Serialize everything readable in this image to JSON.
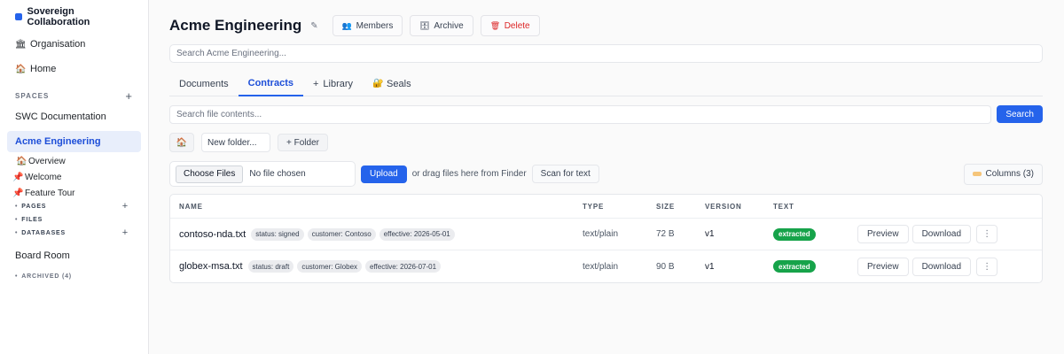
{
  "app": {
    "brand_name": "Sovereign Collaboration",
    "brand_color": "#2563eb"
  },
  "sidebar": {
    "organisation": {
      "icon": "bank-icon",
      "label": "Organisation"
    },
    "home": {
      "icon": "house-icon",
      "label": "Home"
    },
    "spaces_heading": "SPACES",
    "spaces": [
      {
        "label": "SWC Documentation"
      },
      {
        "label": "Acme Engineering",
        "active": true
      }
    ],
    "active_space_children": {
      "overview": "Overview",
      "pages_list": [
        {
          "label": "Welcome"
        },
        {
          "label": "Feature Tour"
        }
      ],
      "sections": {
        "pages": "PAGES",
        "files": "FILES",
        "databases": "DATABASES"
      }
    },
    "board_room": "Board Room",
    "archived": "ARCHIVED (4)"
  },
  "header": {
    "title": "Acme Engineering",
    "buttons": {
      "members": "Members",
      "archive": "Archive",
      "delete": "Delete"
    }
  },
  "search": {
    "placeholder": "Search Acme Engineering..."
  },
  "tabs": [
    {
      "label": "Documents"
    },
    {
      "label": "Contracts",
      "active": true
    },
    {
      "label": "Library",
      "prefix": "+"
    },
    {
      "label": "Seals"
    }
  ],
  "file_search": {
    "placeholder": "Search file contents...",
    "button": "Search"
  },
  "folder": {
    "input_placeholder": "New folder...",
    "add_button": "+ Folder"
  },
  "upload": {
    "choose_label": "Choose Files",
    "no_file": "No file chosen",
    "upload_button": "Upload",
    "drag_text": "or drag files here from Finder",
    "scan_button": "Scan for text",
    "columns_button": "Columns (3)"
  },
  "table": {
    "headers": {
      "name": "NAME",
      "type": "TYPE",
      "size": "SIZE",
      "version": "VERSION",
      "text": "TEXT"
    },
    "actions": {
      "preview": "Preview",
      "download": "Download",
      "more": "⋮"
    },
    "rows": [
      {
        "name": "contoso-nda.txt",
        "tags": [
          "status: signed",
          "customer: Contoso",
          "effective: 2026-05-01"
        ],
        "type": "text/plain",
        "size": "72 B",
        "version": "v1",
        "text_status": "extracted"
      },
      {
        "name": "globex-msa.txt",
        "tags": [
          "status: draft",
          "customer: Globex",
          "effective: 2026-07-01"
        ],
        "type": "text/plain",
        "size": "90 B",
        "version": "v1",
        "text_status": "extracted"
      }
    ]
  },
  "colors": {
    "accent": "#2563eb",
    "danger": "#dc2626",
    "success": "#16a34a",
    "active_bg": "#e8eefb"
  }
}
